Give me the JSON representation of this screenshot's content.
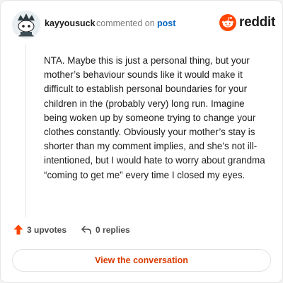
{
  "comment": {
    "username": "kayyousuck",
    "action_text": "commented on",
    "post_link_label": "post",
    "avatar_icon": "snoo-avatar-icon",
    "body": "NTA. Maybe this is just a personal thing, but your mother’s behaviour sounds like it would make it difficult to establish personal boundaries for your children in the (probably very) long run. Imagine being woken up by someone trying to change your clothes constantly. Obviously your mother’s stay is shorter than my comment implies, and she’s not ill-intentioned, but I would hate to worry about grandma “coming to get me” every time I closed my eyes."
  },
  "brand": {
    "logo_text": "reddit",
    "logo_icon": "reddit-snoo-icon",
    "accent_color": "#ff4500"
  },
  "stats": {
    "upvotes_label": "3 upvotes",
    "replies_label": "0 replies",
    "upvote_icon": "upvote-arrow-icon",
    "reply_icon": "reply-arrow-icon"
  },
  "cta": {
    "label": "View the conversation",
    "color": "#d93a00"
  }
}
